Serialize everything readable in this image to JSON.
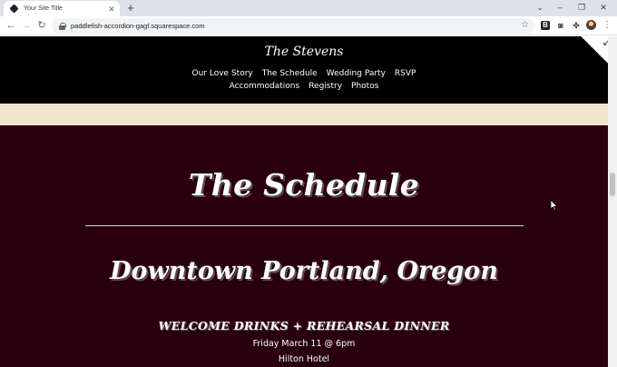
{
  "browser": {
    "tab_title": "Your Site Title",
    "url": "paddlefish-accordion-gagf.squarespace.com",
    "extensions": {
      "b_label": "B"
    }
  },
  "site": {
    "title": "The Stevens",
    "nav_row_1": [
      "Our Love Story",
      "The Schedule",
      "Wedding Party",
      "RSVP"
    ],
    "nav_row_2": [
      "Accommodations",
      "Registry",
      "Photos"
    ]
  },
  "content": {
    "heading": "The Schedule",
    "location": "Downtown Portland, Oregon",
    "event_title": "WELCOME DRINKS + REHEARSAL DINNER",
    "event_time": "Friday March 11 @ 6pm",
    "event_venue": "Hilton Hotel"
  },
  "colors": {
    "header_bg": "#000000",
    "banner_bg": "#efe4cd",
    "section_bg": "#29000d",
    "text": "#ffffff"
  }
}
